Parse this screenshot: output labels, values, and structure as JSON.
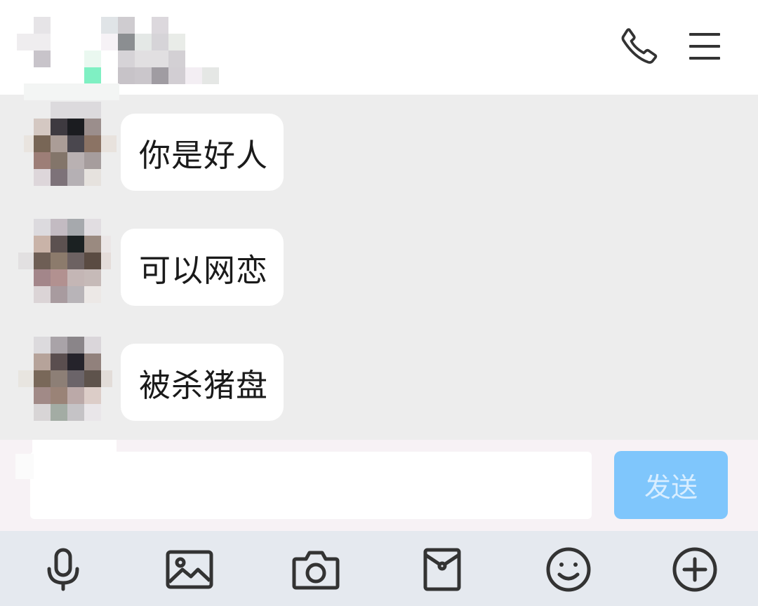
{
  "header": {
    "icons": {
      "call": "phone-icon",
      "menu": "hamburger-menu-icon"
    }
  },
  "messages": [
    {
      "text": "你是好人"
    },
    {
      "text": "可以网恋"
    },
    {
      "text": "被杀猪盘"
    }
  ],
  "input": {
    "value": "",
    "placeholder": ""
  },
  "send": {
    "label": "发送",
    "state": "disabled"
  },
  "toolbar": {
    "icons": [
      "microphone-icon",
      "image-icon",
      "camera-icon",
      "red-envelope-icon",
      "emoji-icon",
      "plus-icon"
    ]
  },
  "colors": {
    "chat_background": "#ededed",
    "header_background": "#ffffff",
    "bubble": "#ffffff",
    "send_button": "#7fc6fc",
    "toolbar_background": "#e5e9ef",
    "icon": "#333333"
  }
}
